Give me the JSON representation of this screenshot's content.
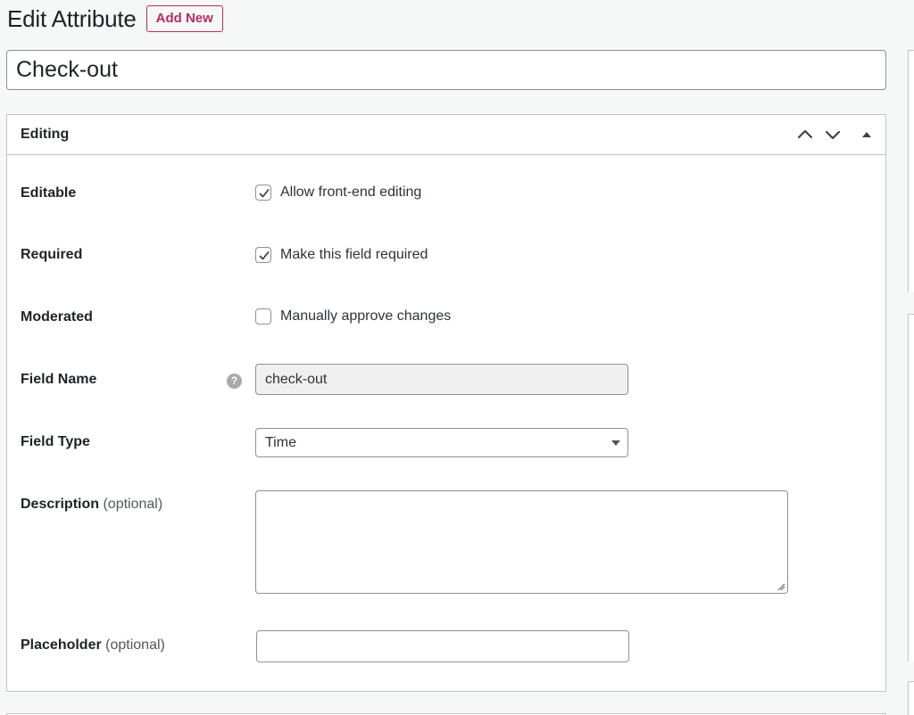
{
  "header": {
    "title": "Edit Attribute",
    "add_new_label": "Add New"
  },
  "attribute_title": {
    "value": "Check-out"
  },
  "editing_box": {
    "title": "Editing",
    "move_up_icon": "chevron-up-icon",
    "move_down_icon": "chevron-down-icon",
    "toggle_icon": "triangle-up-icon"
  },
  "fields": {
    "editable": {
      "label": "Editable",
      "checkbox_label": "Allow front-end editing",
      "checked": true
    },
    "required": {
      "label": "Required",
      "checkbox_label": "Make this field required",
      "checked": true
    },
    "moderated": {
      "label": "Moderated",
      "checkbox_label": "Manually approve changes",
      "checked": false
    },
    "field_name": {
      "label": "Field Name",
      "help_icon": "question-mark-icon",
      "value": "check-out"
    },
    "field_type": {
      "label": "Field Type",
      "selected": "Time"
    },
    "description": {
      "label": "Description",
      "optional": "(optional)",
      "value": ""
    },
    "placeholder": {
      "label": "Placeholder",
      "optional": "(optional)",
      "value": ""
    }
  },
  "colors": {
    "accent": "#b32d5e",
    "border": "#c3c4c7",
    "background": "#f6f7f7"
  }
}
